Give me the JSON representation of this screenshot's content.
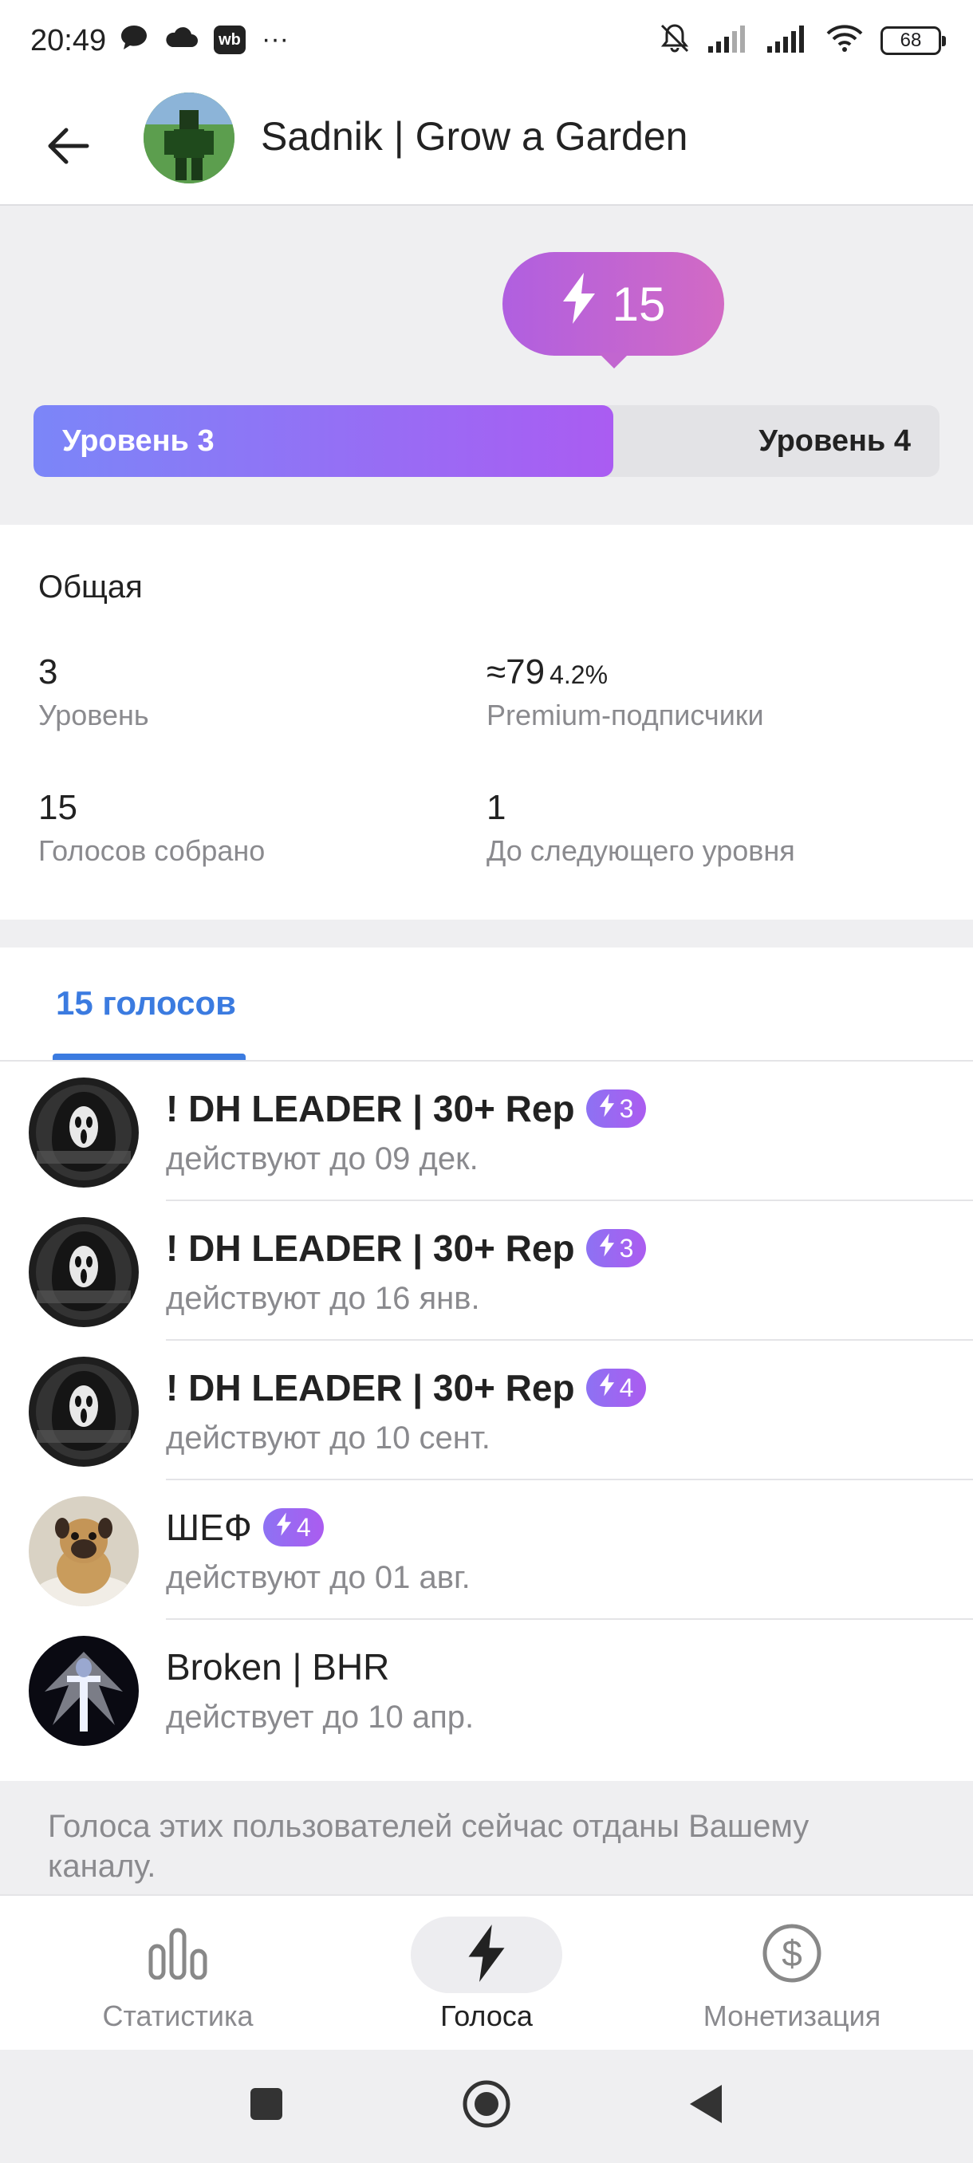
{
  "status_bar": {
    "time": "20:49",
    "wb_badge": "wb",
    "more": "···",
    "battery": "68",
    "icons": [
      "chat-icon",
      "cloud-icon",
      "wb-icon",
      "mute-icon",
      "signal-icon",
      "signal-icon",
      "wifi-icon",
      "battery-icon"
    ]
  },
  "header": {
    "title": "Sadnik | Grow a Garden",
    "back_icon": "arrow-left-icon"
  },
  "boost": {
    "count": "15",
    "current_level": "Уровень 3",
    "next_level": "Уровень 4",
    "progress_fraction": 0.64,
    "colors": {
      "start": "#7b86f8",
      "end": "#aa5cf2",
      "bubble": "#c266d0"
    }
  },
  "general": {
    "title": "Общая",
    "level_value": "3",
    "level_label": "Уровень",
    "premium_value": "≈79",
    "premium_percent": "4.2%",
    "premium_label": "Premium-подписчики",
    "boosts_value": "15",
    "boosts_label": "Голосов собрано",
    "remaining_value": "1",
    "remaining_label": "До следующего уровня"
  },
  "list": {
    "tab_label": "15 голосов",
    "items": [
      {
        "name": "! DH LEADER | 30+ Rep",
        "boosts": "3",
        "sub": "действуют до 09 дек."
      },
      {
        "name": "! DH LEADER | 30+ Rep",
        "boosts": "3",
        "sub": "действуют до 16 янв."
      },
      {
        "name": "! DH LEADER | 30+ Rep",
        "boosts": "4",
        "sub": "действуют до 10 сент."
      },
      {
        "name": "ШЕФ",
        "boosts": "4",
        "sub": "действуют до 01 авг."
      },
      {
        "name": "Broken | BHR",
        "boosts": "",
        "sub": "действует до 10 апр."
      }
    ]
  },
  "note": "Голоса этих пользователей сейчас отданы Вашему каналу.",
  "bottom_nav": {
    "stats_label": "Статистика",
    "boosts_label": "Голоса",
    "monetization_label": "Монетизация",
    "active": "boosts"
  },
  "accent_color": "#3b7be0"
}
